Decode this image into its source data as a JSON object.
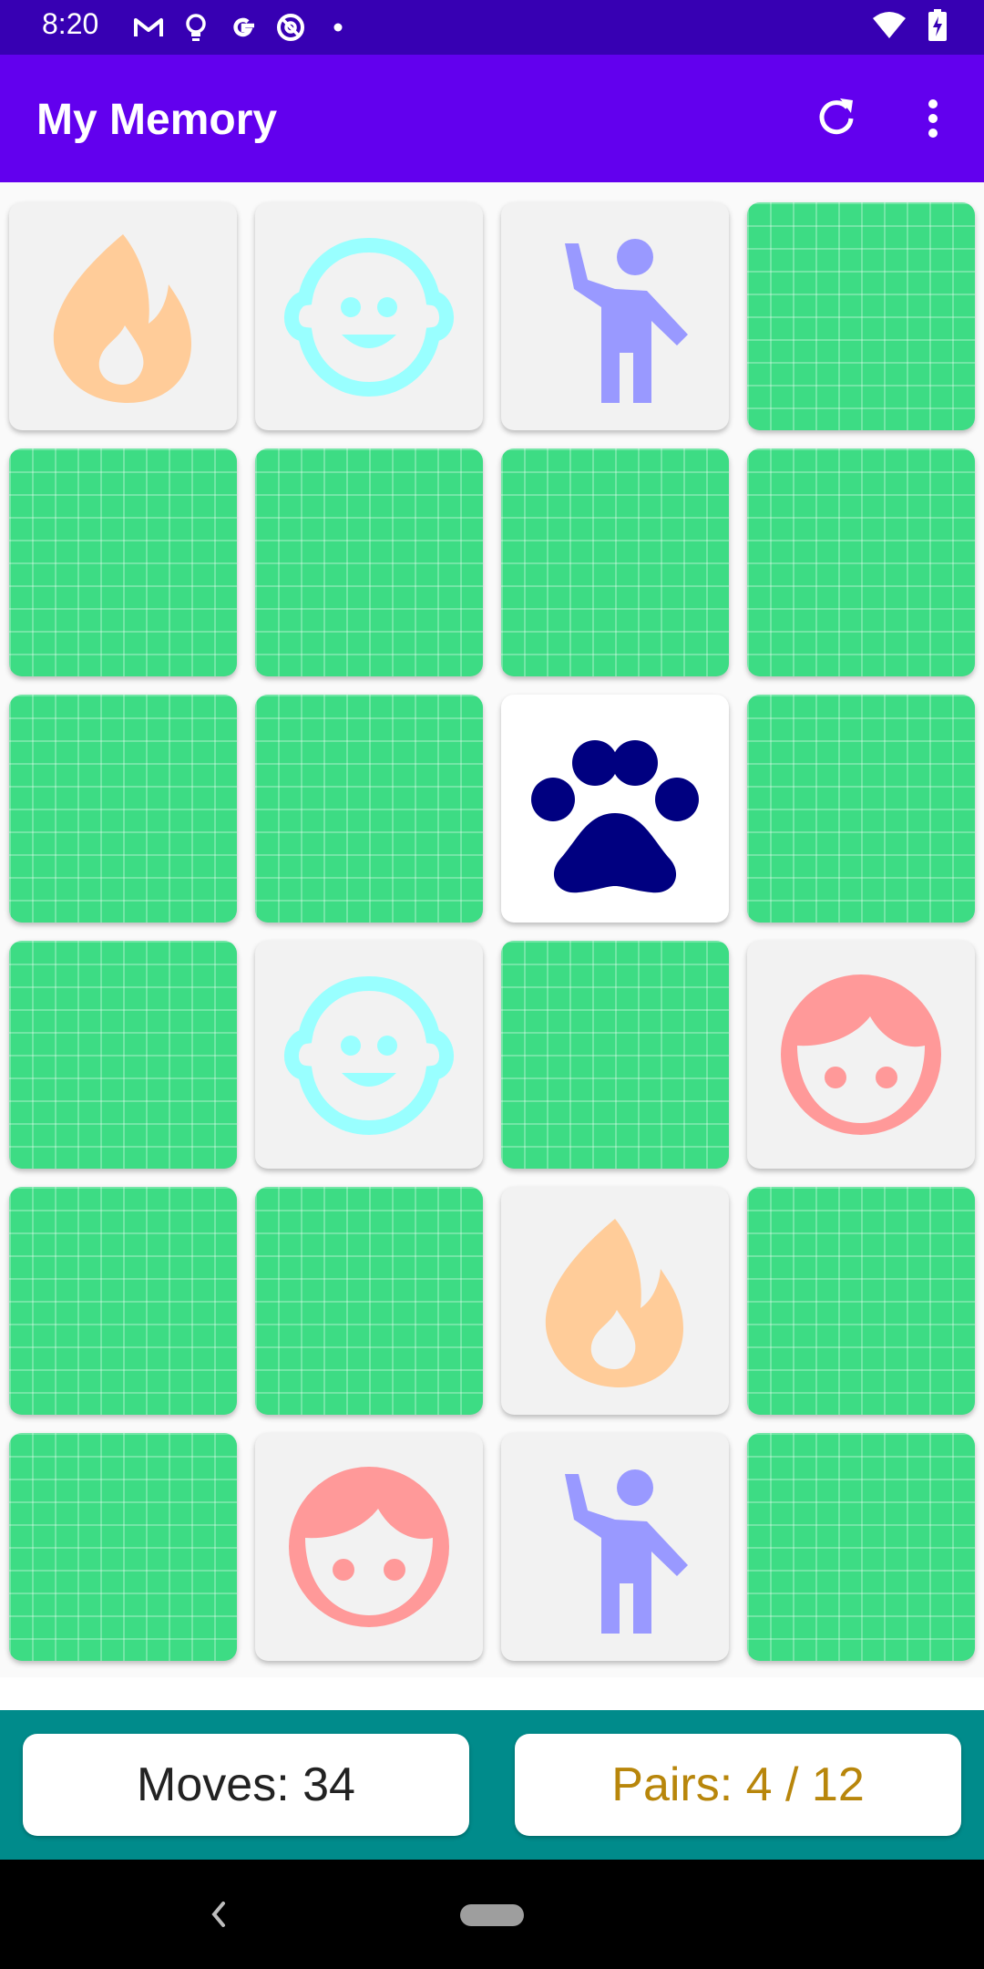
{
  "status_bar": {
    "time": "8:20",
    "notification_icons": [
      "gmail-icon",
      "lightbulb-icon",
      "google-icon",
      "at-sign-icon",
      "dot-icon"
    ],
    "right_icons": [
      "wifi-icon",
      "battery-charging-icon"
    ]
  },
  "app_bar": {
    "title": "My Memory",
    "actions": [
      "refresh-icon",
      "more-vert-icon"
    ]
  },
  "colors": {
    "status_bar": "#3700b3",
    "app_bar": "#6200ee",
    "card_back": "#3ddc84",
    "footer": "#008b8b",
    "pairs_text": "#b8860b",
    "fire": "#ffcc99",
    "baby": "#99ffff",
    "person": "#9999ff",
    "face": "#ff9999",
    "paw": "#000080"
  },
  "board": {
    "columns": 4,
    "rows": 6,
    "cards": [
      {
        "state": "matched",
        "icon": "fire-icon"
      },
      {
        "state": "matched",
        "icon": "baby-face-icon"
      },
      {
        "state": "matched",
        "icon": "waving-person-icon"
      },
      {
        "state": "back",
        "icon": "card-back"
      },
      {
        "state": "back",
        "icon": "card-back"
      },
      {
        "state": "back",
        "icon": "card-back"
      },
      {
        "state": "back",
        "icon": "card-back"
      },
      {
        "state": "back",
        "icon": "card-back"
      },
      {
        "state": "back",
        "icon": "card-back"
      },
      {
        "state": "back",
        "icon": "card-back"
      },
      {
        "state": "faceup",
        "icon": "paw-icon"
      },
      {
        "state": "back",
        "icon": "card-back"
      },
      {
        "state": "back",
        "icon": "card-back"
      },
      {
        "state": "matched",
        "icon": "baby-face-icon"
      },
      {
        "state": "back",
        "icon": "card-back"
      },
      {
        "state": "matched",
        "icon": "face-icon"
      },
      {
        "state": "back",
        "icon": "card-back"
      },
      {
        "state": "back",
        "icon": "card-back"
      },
      {
        "state": "matched",
        "icon": "fire-icon"
      },
      {
        "state": "back",
        "icon": "card-back"
      },
      {
        "state": "back",
        "icon": "card-back"
      },
      {
        "state": "matched",
        "icon": "face-icon"
      },
      {
        "state": "matched",
        "icon": "waving-person-icon"
      },
      {
        "state": "back",
        "icon": "card-back"
      }
    ]
  },
  "footer": {
    "moves_label": "Moves: 34",
    "pairs_label": "Pairs: 4 / 12"
  },
  "nav_bar": {
    "icons": [
      "back-icon",
      "home-pill-icon"
    ]
  }
}
